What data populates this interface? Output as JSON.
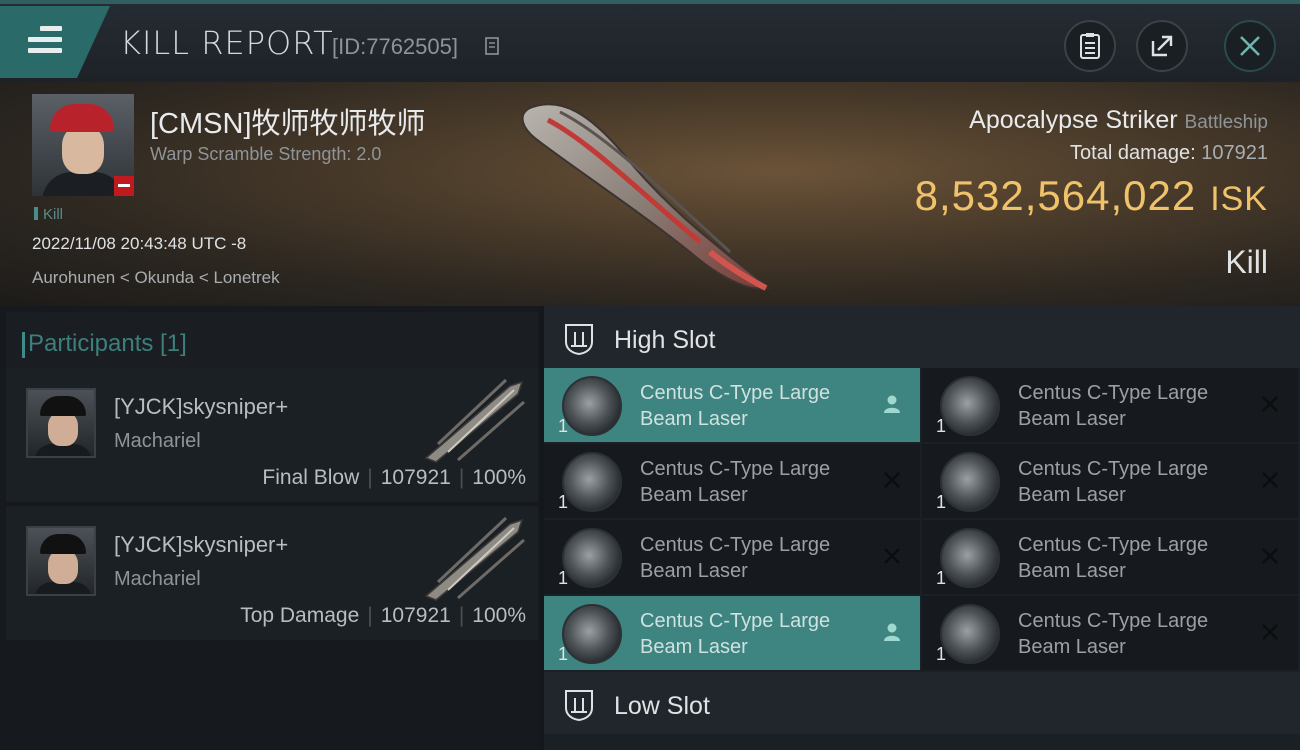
{
  "header": {
    "title": "KILL REPORT",
    "id": "[ID:7762505]"
  },
  "victim": {
    "name": "[CMSN]牧师牧师牧师",
    "warp_scramble": "Warp Scramble Strength: 2.0",
    "tag": "Kill",
    "datetime": "2022/11/08 20:43:48 UTC -8",
    "location": "Aurohunen < Okunda < Lonetrek"
  },
  "ship": {
    "name": "Apocalypse Striker",
    "class": "Battleship",
    "total_damage_label": "Total damage:",
    "total_damage_value": "107921",
    "isk_value": "8,532,564,022",
    "isk_unit": "ISK",
    "result": "Kill"
  },
  "participants": {
    "title": "Participants [1]",
    "rows": [
      {
        "name": "[YJCK]skysniper+",
        "ship": "Machariel",
        "role": "Final Blow",
        "damage": "107921",
        "percent": "100%"
      },
      {
        "name": "[YJCK]skysniper+",
        "ship": "Machariel",
        "role": "Top Damage",
        "damage": "107921",
        "percent": "100%"
      }
    ]
  },
  "slots": {
    "high_title": "High Slot",
    "low_title": "Low Slot",
    "high_modules": [
      {
        "line1": "Centus C-Type Large",
        "line2": "Beam Laser",
        "qty": "1",
        "state": "dropped"
      },
      {
        "line1": "Centus C-Type Large",
        "line2": "Beam Laser",
        "qty": "1",
        "state": "destroyed"
      },
      {
        "line1": "Centus C-Type Large",
        "line2": "Beam Laser",
        "qty": "1",
        "state": "destroyed"
      },
      {
        "line1": "Centus C-Type Large",
        "line2": "Beam Laser",
        "qty": "1",
        "state": "destroyed"
      },
      {
        "line1": "Centus C-Type Large",
        "line2": "Beam Laser",
        "qty": "1",
        "state": "destroyed"
      },
      {
        "line1": "Centus C-Type Large",
        "line2": "Beam Laser",
        "qty": "1",
        "state": "destroyed"
      },
      {
        "line1": "Centus C-Type Large",
        "line2": "Beam Laser",
        "qty": "1",
        "state": "dropped"
      },
      {
        "line1": "Centus C-Type Large",
        "line2": "Beam Laser",
        "qty": "1",
        "state": "destroyed"
      }
    ]
  },
  "colors": {
    "accent_teal": "#3e8480",
    "isk_gold": "#f0c36b",
    "victim_red": "#c0191f"
  },
  "icons": {
    "menu": "hamburger-icon",
    "copy": "copy-icon",
    "clipboard": "clipboard-icon",
    "share": "share-icon",
    "close": "close-icon",
    "slot": "high-slot-icon",
    "dropped": "person-icon",
    "destroyed": "x-icon"
  }
}
